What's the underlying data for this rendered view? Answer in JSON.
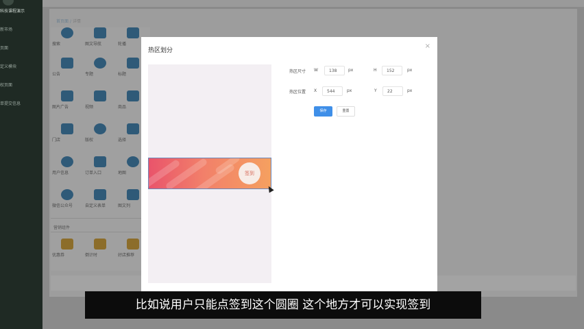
{
  "sidebar": {
    "items": [
      {
        "label": "科技课程演示"
      },
      {
        "label": "新市场"
      },
      {
        "label": "页面"
      },
      {
        "label": "定义模块"
      },
      {
        "label": "权页面"
      },
      {
        "label": "单提交信息"
      }
    ]
  },
  "breadcrumb": {
    "home": "首页面",
    "separator": "/",
    "current": "详情"
  },
  "components": {
    "rows": [
      [
        "搜索",
        "图文导航",
        "轮播"
      ],
      [
        "公告",
        "专题",
        "标题"
      ],
      [
        "图片广告",
        "视频",
        "商品"
      ],
      [
        "门店",
        "版权",
        "选择"
      ],
      [
        "用户信息",
        "订单入口",
        "地图"
      ],
      [
        "微信公众号",
        "自定义表单",
        "图文列"
      ]
    ],
    "section_title": "营销组件",
    "marketing": [
      "优惠券",
      "倒计时",
      "好店推荐"
    ]
  },
  "modal": {
    "title": "热区划分",
    "close_icon": "×",
    "banner_button": "签到",
    "size": {
      "label": "热区尺寸",
      "w_label": "W",
      "w_value": "138",
      "w_unit": "px",
      "h_label": "H",
      "h_value": "152",
      "h_unit": "px"
    },
    "position": {
      "label": "热区位置",
      "x_label": "X",
      "x_value": "544",
      "x_unit": "px",
      "y_label": "Y",
      "y_value": "22",
      "y_unit": "px"
    },
    "save_label": "保存",
    "reset_label": "重置"
  },
  "subtitle": "比如说用户只能点签到这个圆圈 这个地方才可以实现签到",
  "colors": {
    "primary": "#3f8fe8",
    "sidebar": "#1f2a24",
    "banner_start": "#e9546b",
    "banner_end": "#f5a060"
  }
}
